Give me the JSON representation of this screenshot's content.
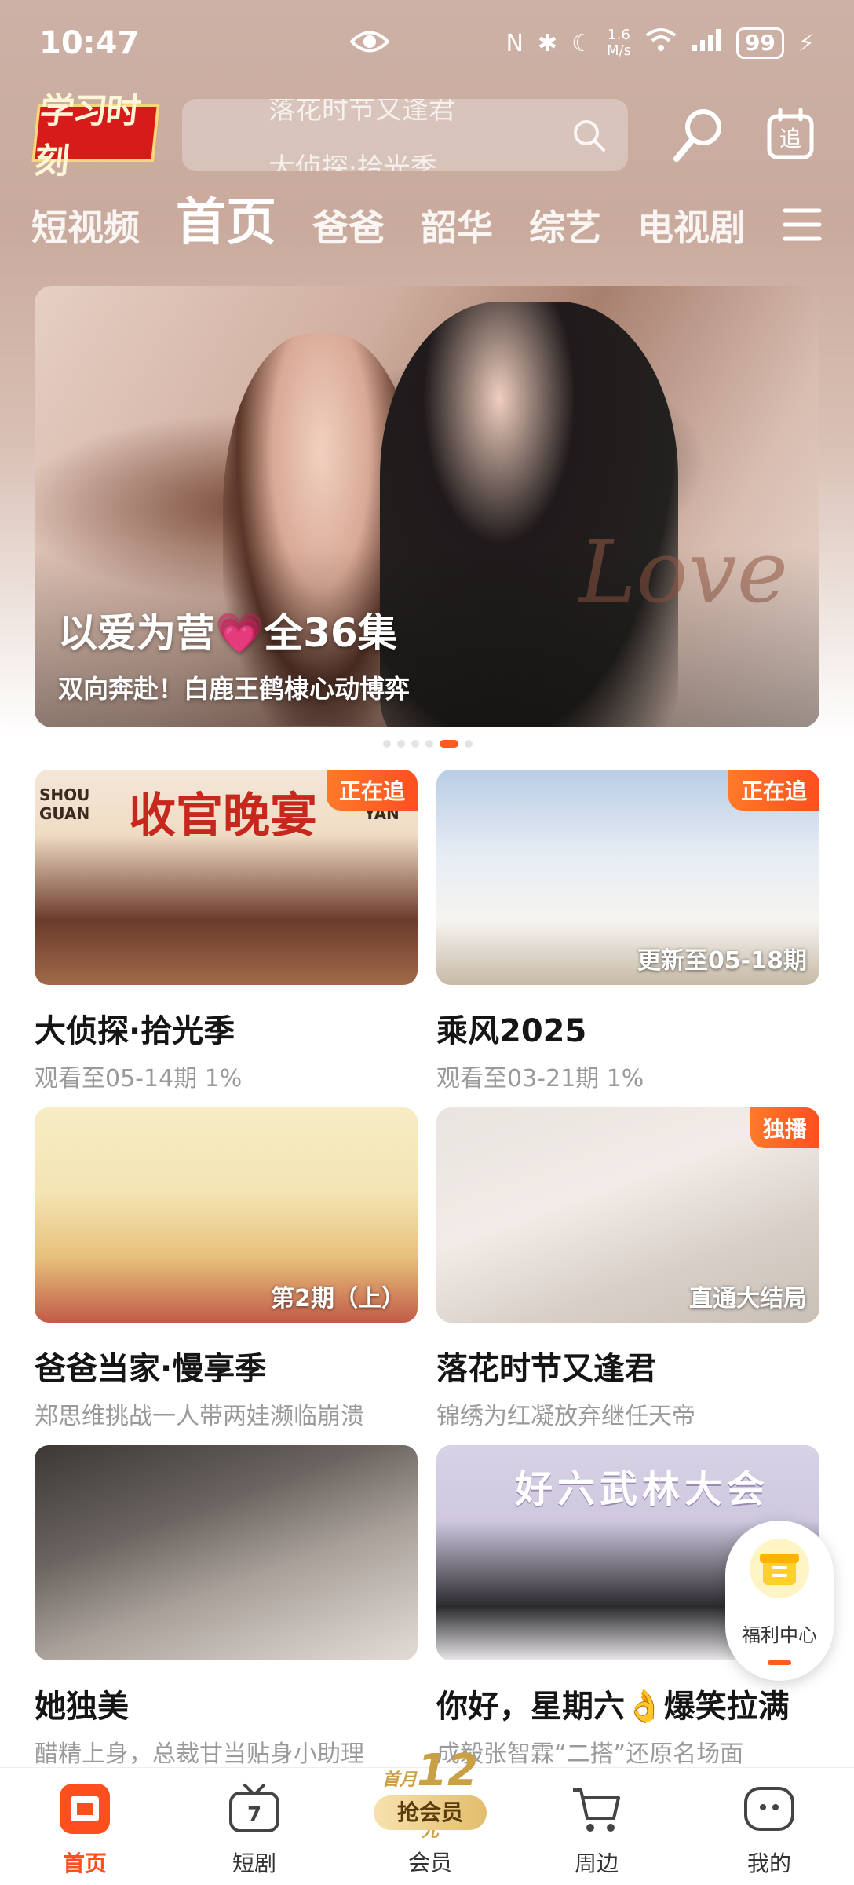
{
  "status_bar": {
    "time": "10:47",
    "speed": "1.6",
    "speed_unit": "M/s",
    "battery": "99"
  },
  "header": {
    "logo_text": "学习时刻",
    "search_roll_prev": "落花时节又逢君",
    "search_roll_current": "大侦探·拾光季"
  },
  "tabs": [
    "短视频",
    "首页",
    "爸爸",
    "韶华",
    "综艺",
    "电视剧"
  ],
  "active_tab": "首页",
  "banner": {
    "title_part1": "以爱为营",
    "title_part2": "全36集",
    "subtitle": "双向奔赴！白鹿王鹤棣心动博弈",
    "script_text": "Love"
  },
  "cards": [
    {
      "title": "大侦探·拾光季",
      "subtitle": "观看至05-14期 1%",
      "badge": "正在追",
      "overlay": "",
      "poster": "收官晚宴",
      "poster_en_left": "SHOU GUAN",
      "poster_en_right": "YAN"
    },
    {
      "title": "乘风2025",
      "subtitle": "观看至03-21期 1%",
      "badge": "正在追",
      "overlay": "更新至05-18期",
      "poster": ""
    },
    {
      "title": "爸爸当家·慢享季",
      "subtitle": "郑思维挑战一人带两娃濒临崩溃",
      "badge": "",
      "overlay": "第2期（上）",
      "poster": ""
    },
    {
      "title": "落花时节又逢君",
      "subtitle": "锦绣为红凝放弃继任天帝",
      "badge": "独播",
      "overlay": "直通大结局",
      "poster": ""
    },
    {
      "title": "她独美",
      "subtitle": "醋精上身，总裁甘当贴身小助理",
      "badge": "",
      "overlay": "",
      "poster": ""
    },
    {
      "title": "你好，星期六👌爆笑拉满",
      "subtitle": "成毅张智霖“二搭”还原名场面",
      "badge": "",
      "overlay": "",
      "poster": "好六武林大会"
    }
  ],
  "welfare": {
    "label": "福利中心"
  },
  "bottom_nav": {
    "home": "首页",
    "short_drama": "短剧",
    "vip_price": "12",
    "vip_prefix": "首月",
    "vip_unit": "元",
    "vip_cta": "抢会员",
    "vip": "会员",
    "nearby": "周边",
    "mine": "我的"
  },
  "colors": {
    "accent": "#ff5a1f",
    "badge": "#ff6a24"
  }
}
